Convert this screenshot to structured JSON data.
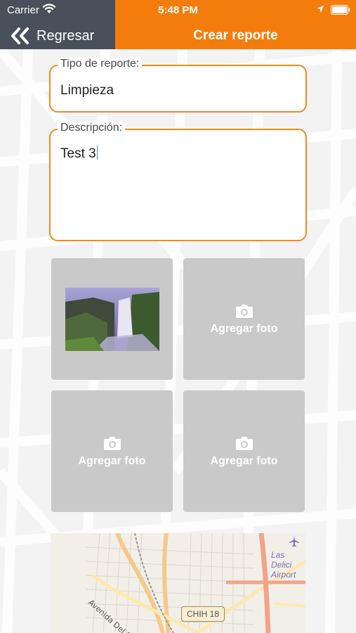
{
  "status_bar": {
    "carrier": "Carrier",
    "time": "5:48 PM"
  },
  "nav": {
    "back_label": "Regresar",
    "title": "Crear reporte"
  },
  "form": {
    "tipo_label": "Tipo de reporte:",
    "tipo_value": "Limpieza",
    "desc_label": "Descripción:",
    "desc_value": "Test 3"
  },
  "photos": {
    "add_label": "Agregar foto"
  },
  "map": {
    "road_label": "CHIH 18",
    "airport_label_1": "Las Delici",
    "airport_label_2": "Airport",
    "street_label": "Avenida Del Parque"
  },
  "colors": {
    "accent": "#f47c0d",
    "nav_dark": "#48505b",
    "tile": "#c9c9c9",
    "field_border": "#f08a1f"
  },
  "icons": [
    "wifi-icon",
    "location-arrow-icon",
    "battery-icon",
    "double-chevron-left-icon",
    "camera-icon",
    "airport-icon"
  ]
}
